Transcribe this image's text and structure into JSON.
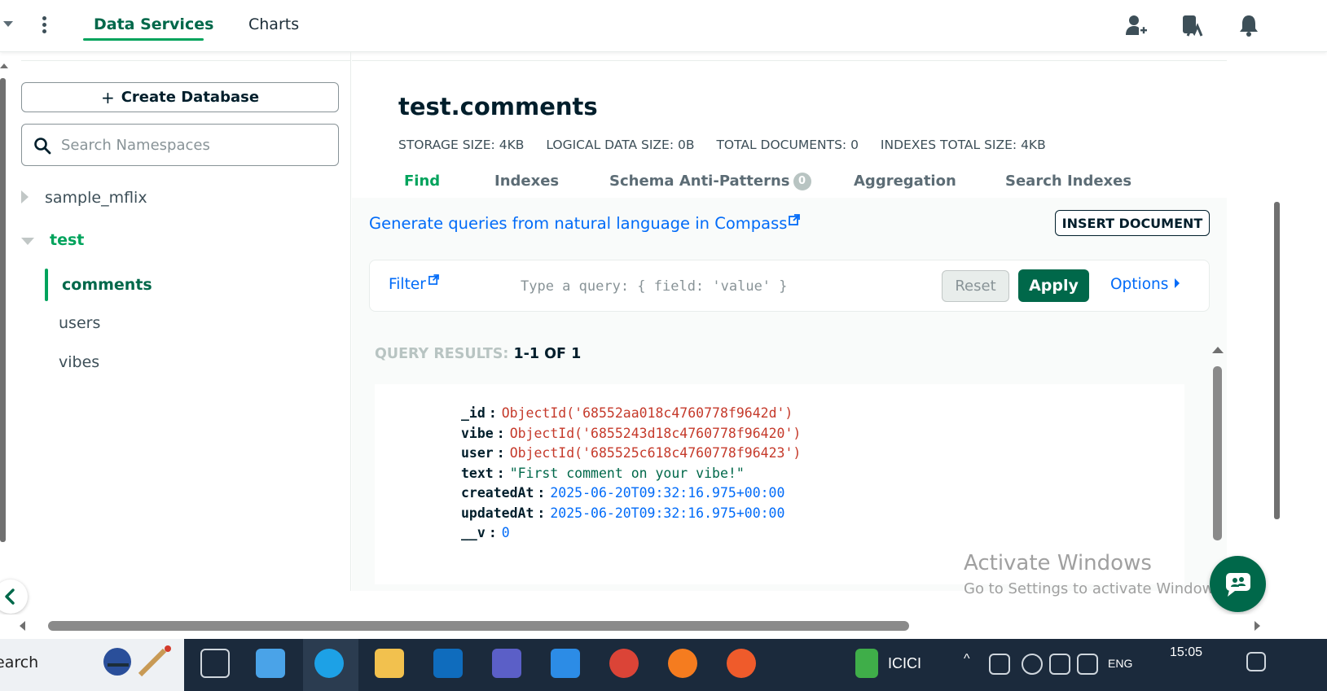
{
  "nav": {
    "tabs": [
      "Data Services",
      "Charts"
    ]
  },
  "sidebar": {
    "create_label": "Create Database",
    "search_placeholder": "Search Namespaces",
    "databases": [
      "sample_mflix",
      "test"
    ],
    "collections": [
      "comments",
      "users",
      "vibes"
    ]
  },
  "main": {
    "title": "test.comments",
    "stats": [
      {
        "label": "STORAGE SIZE:",
        "value": "4KB"
      },
      {
        "label": "LOGICAL DATA SIZE:",
        "value": "0B"
      },
      {
        "label": "TOTAL DOCUMENTS:",
        "value": "0"
      },
      {
        "label": "INDEXES TOTAL SIZE:",
        "value": "4KB"
      }
    ],
    "tabs": [
      "Find",
      "Indexes",
      "Schema Anti-Patterns",
      "Aggregation",
      "Search Indexes"
    ],
    "schema_count": "0",
    "nl_link": "Generate queries from natural language in Compass",
    "insert_label": "INSERT DOCUMENT",
    "filter": {
      "label": "Filter",
      "placeholder": "Type a query: { field: 'value' }",
      "reset": "Reset",
      "apply": "Apply",
      "options": "Options"
    },
    "results": {
      "label": "QUERY RESULTS:",
      "value": "1-1 OF 1"
    },
    "document": [
      {
        "key": "_id",
        "value": "ObjectId('68552aa018c4760778f9642d')",
        "color": "#c53a2b"
      },
      {
        "key": "vibe",
        "value": "ObjectId('6855243d18c4760778f96420')",
        "color": "#c53a2b"
      },
      {
        "key": "user",
        "value": "ObjectId('685525c618c4760778f96423')",
        "color": "#c53a2b"
      },
      {
        "key": "text",
        "value": "\"First comment on your vibe!\"",
        "color": "#00684a"
      },
      {
        "key": "createdAt",
        "value": "2025-06-20T09:32:16.975+00:00",
        "color": "#016bf8"
      },
      {
        "key": "updatedAt",
        "value": "2025-06-20T09:32:16.975+00:00",
        "color": "#016bf8"
      },
      {
        "key": "__v",
        "value": "0",
        "color": "#016bf8"
      }
    ]
  },
  "watermark": {
    "line1": "Activate Windows",
    "line2": "Go to Settings to activate Windows."
  },
  "taskbar": {
    "search_text": "earch",
    "weather_text": "ICICI",
    "lang": "ENG",
    "time": "15:05"
  },
  "colors": {
    "brand_green": "#00684a",
    "accent_green": "#00a35c",
    "link_blue": "#016bf8",
    "objectid_red": "#c53a2b"
  }
}
